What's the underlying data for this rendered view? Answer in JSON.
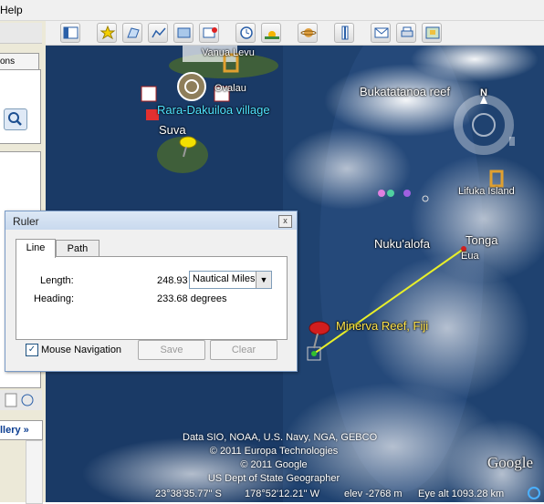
{
  "menu": {
    "help": "Help"
  },
  "sidebar": {
    "tab_label": "ons",
    "gallery_label": "llery »"
  },
  "map": {
    "labels": {
      "vanua_levu": "Vanua Levu",
      "ovalau": "Ovalau",
      "rara_dakuiloa": "Rara-Dakuiloa village",
      "suva": "Suva",
      "reef": "Bukatatanoa reef",
      "lifuka": "Lifuka Island",
      "nukualofa": "Nuku'alofa",
      "tonga": "Tonga",
      "eua": "Eua",
      "minerva": "Minerva Reef, Fiji"
    },
    "attribution": [
      "Data SIO, NOAA, U.S. Navy, NGA, GEBCO",
      "© 2011 Europa Technologies",
      "© 2011 Google",
      "US Dept of State Geographer"
    ],
    "google_logo": "Google",
    "compass_n": "N"
  },
  "status": {
    "lat": "23°38'35.77\" S",
    "lon": "178°52'12.21\" W",
    "elev": "elev -2768 m",
    "eye_alt": "Eye alt  1093.28 km"
  },
  "ruler": {
    "title": "Ruler",
    "close": "x",
    "tabs": [
      "Line",
      "Path"
    ],
    "length_label": "Length:",
    "length_value": "248.93",
    "unit": "Nautical Miles",
    "heading_label": "Heading:",
    "heading_value": "233.68 degrees",
    "mouse_nav_label": "Mouse Navigation",
    "mouse_nav_checked": true,
    "save_label": "Save",
    "clear_label": "Clear"
  },
  "colors": {
    "ocean": "#1a3a66",
    "ruler_line": "#e8ef2a",
    "label_yellow": "#ffe34a",
    "label_cyan": "#4fe3ff"
  }
}
